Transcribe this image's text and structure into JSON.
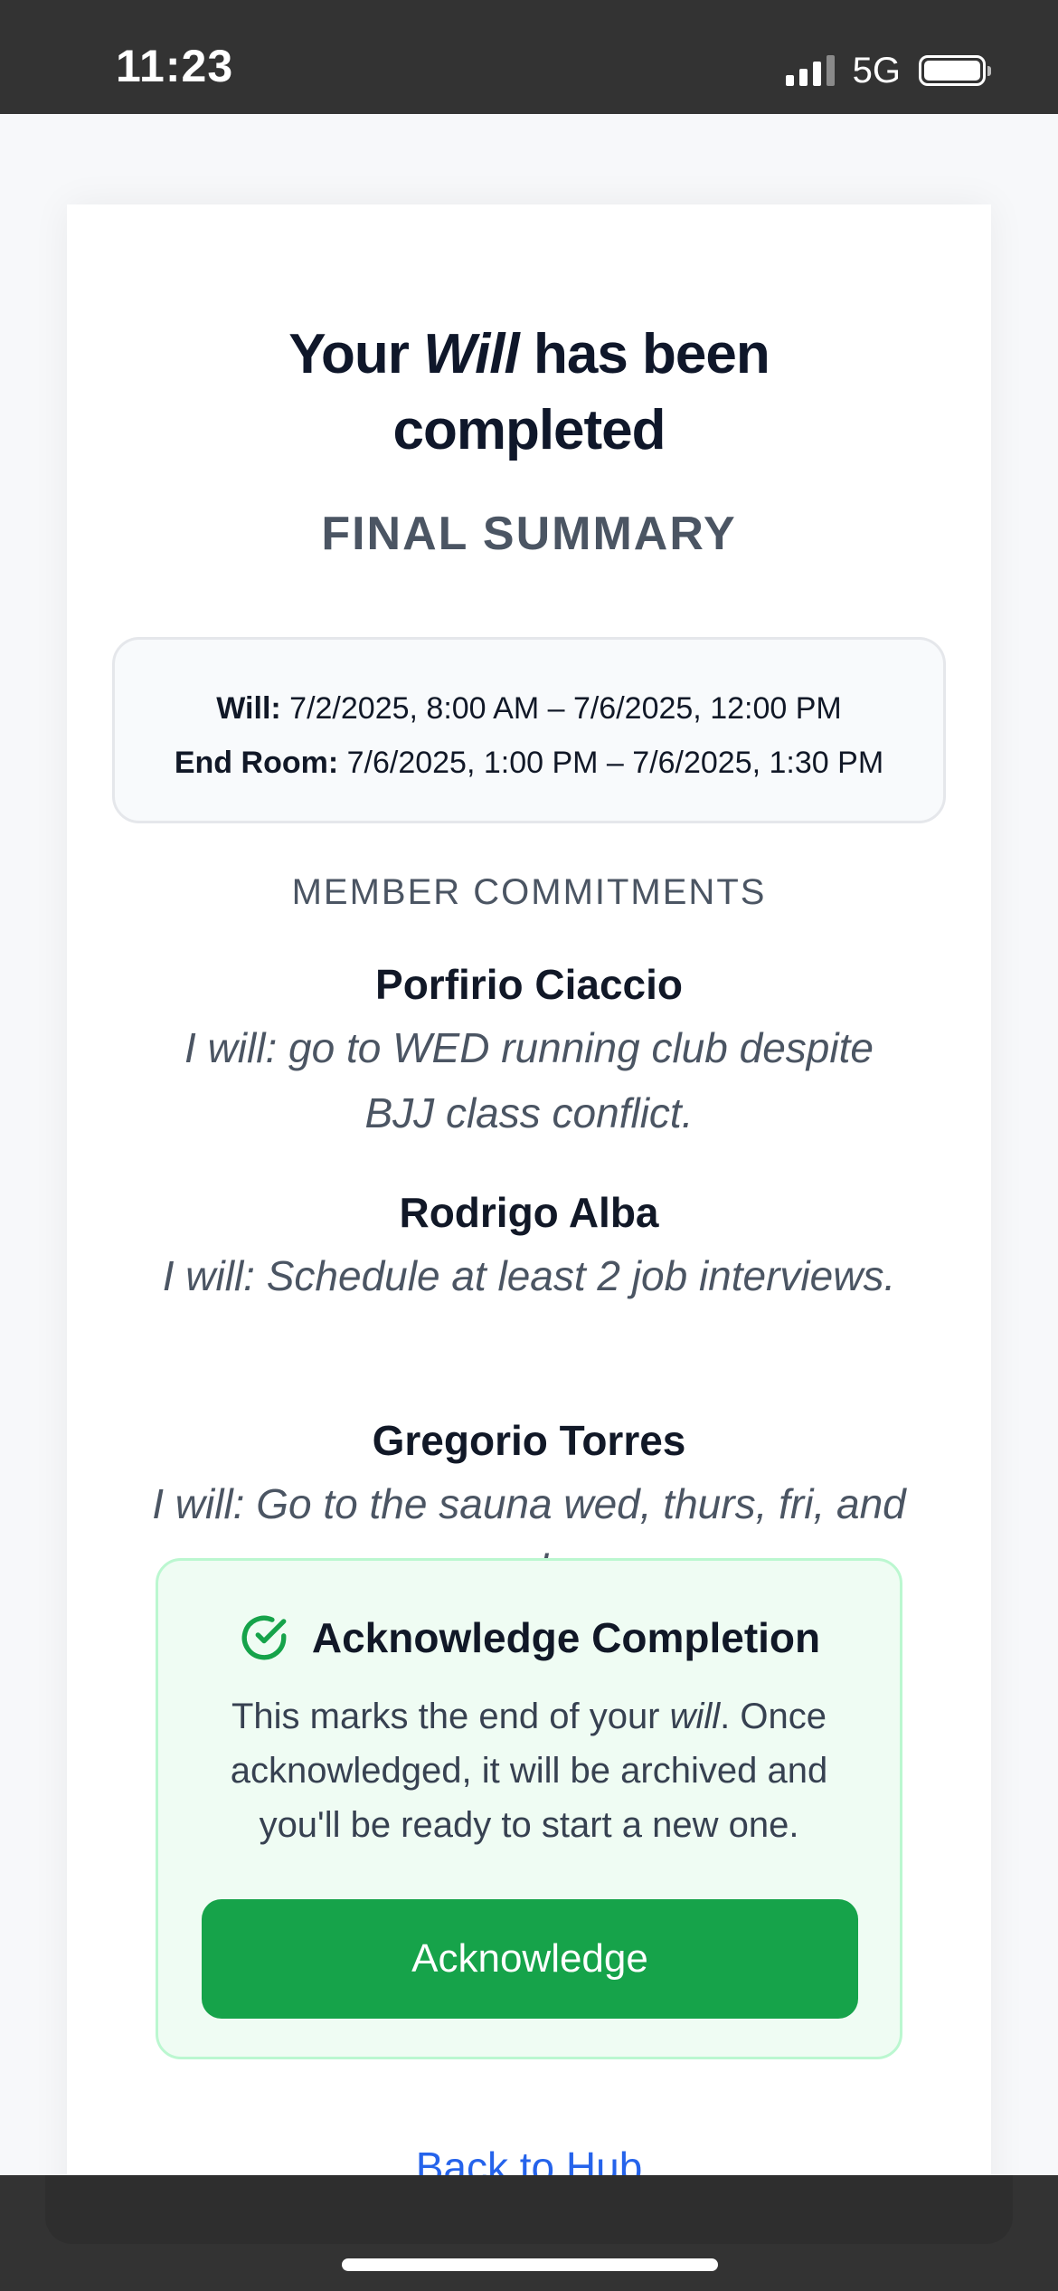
{
  "status_bar": {
    "time": "11:23",
    "network": "5G"
  },
  "header": {
    "title_before": "Your ",
    "title_italic": "Will",
    "title_after": " has been",
    "title_line2": "completed",
    "subtitle": "FINAL SUMMARY"
  },
  "dates": {
    "will_label": "Will:",
    "will_value": " 7/2/2025, 8:00 AM – 7/6/2025, 12:00 PM",
    "end_room_label": "End Room:",
    "end_room_value": " 7/6/2025, 1:00 PM – 7/6/2025, 1:30 PM"
  },
  "commitments": {
    "heading": "MEMBER COMMITMENTS",
    "members": [
      {
        "name": "Porfirio Ciaccio",
        "commitment": "I will: go to WED running club despite BJJ class conflict."
      },
      {
        "name": "Rodrigo Alba",
        "commitment": "I will: Schedule at least 2 job interviews."
      },
      {
        "name": "Gregorio Torres",
        "commitment": "I will: Go to the sauna wed, thurs, fri, and sunday."
      }
    ]
  },
  "acknowledge": {
    "title": "Acknowledge Completion",
    "body_before": "This marks the end of your ",
    "body_italic": "will",
    "body_after": ". Once acknowledged, it will be archived and you'll be ready to start a new one.",
    "button_label": "Acknowledge",
    "accent_color": "#16a34a"
  },
  "footer": {
    "back_link": "Back to Hub"
  },
  "icons": {
    "check": "check-circle-icon",
    "signal": "signal-icon",
    "battery": "battery-icon"
  }
}
